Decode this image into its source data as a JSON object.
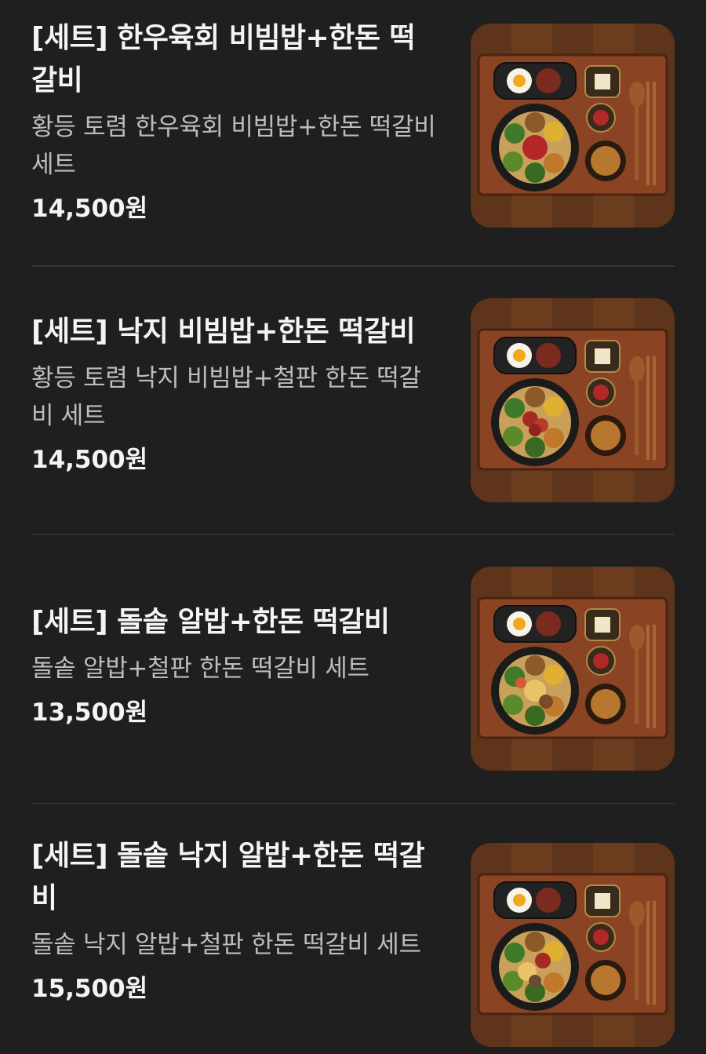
{
  "menu": {
    "items": [
      {
        "name": "[세트] 한우육회 비빔밥+한돈 떡갈비",
        "description": "황등 토렴 한우육회 비빔밥+한돈 떡갈비 세트",
        "price": "14,500원",
        "image_alt": "한우육회 비빔밥 세트",
        "bowl_topping": "yukhoe"
      },
      {
        "name": "[세트] 낙지 비빔밥+한돈 떡갈비",
        "description": "황등 토렴 낙지 비빔밥+철판 한돈 떡갈비 세트",
        "price": "14,500원",
        "image_alt": "낙지 비빔밥 세트",
        "bowl_topping": "nakji"
      },
      {
        "name": "[세트] 돌솥 알밥+한돈 떡갈비",
        "description": "돌솥 알밥+철판 한돈 떡갈비 세트",
        "price": "13,500원",
        "image_alt": "돌솥 알밥 세트",
        "bowl_topping": "albap"
      },
      {
        "name": "[세트] 돌솥 낙지 알밥+한돈 떡갈비",
        "description": "돌솥 낙지 알밥+철판 한돈 떡갈비 세트",
        "price": "15,500원",
        "image_alt": "돌솥 낙지 알밥 세트",
        "bowl_topping": "nakji-albap"
      }
    ]
  },
  "colors": {
    "background": "#1f1f1f",
    "text_primary": "#f4f4f4",
    "text_secondary": "#bdbdbd",
    "divider": "#333333",
    "wood": "#6b3a1f",
    "tray": "#8a4423"
  }
}
